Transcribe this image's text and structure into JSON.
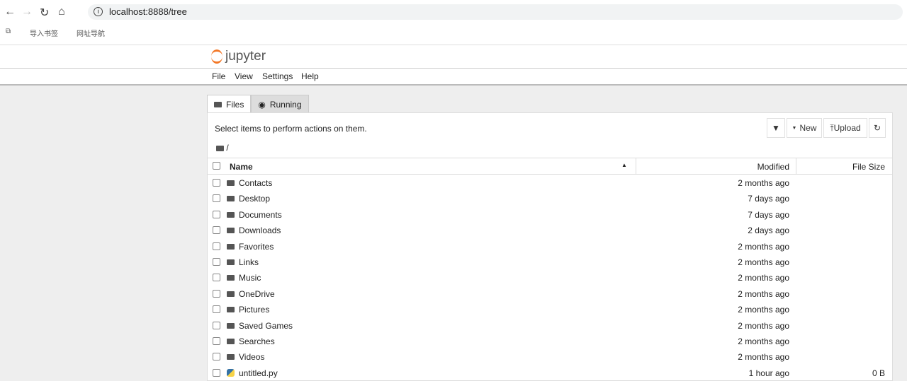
{
  "browser": {
    "url": "localhost:8888/tree",
    "bookmarks": [
      "导入书签",
      "网址导航"
    ]
  },
  "app": {
    "logo": "jupyter",
    "menu": [
      "File",
      "View",
      "Settings",
      "Help"
    ],
    "tabs": [
      "Files",
      "Running"
    ],
    "hint": "Select items to perform actions on them.",
    "toolbar": {
      "new": "New",
      "upload": "Upload"
    },
    "breadcrumb": "/",
    "columns": {
      "name": "Name",
      "modified": "Modified",
      "size": "File Size"
    },
    "rows": [
      {
        "name": "Contacts",
        "modified": "2 months ago",
        "size": "",
        "type": "folder"
      },
      {
        "name": "Desktop",
        "modified": "7 days ago",
        "size": "",
        "type": "folder"
      },
      {
        "name": "Documents",
        "modified": "7 days ago",
        "size": "",
        "type": "folder"
      },
      {
        "name": "Downloads",
        "modified": "2 days ago",
        "size": "",
        "type": "folder"
      },
      {
        "name": "Favorites",
        "modified": "2 months ago",
        "size": "",
        "type": "folder"
      },
      {
        "name": "Links",
        "modified": "2 months ago",
        "size": "",
        "type": "folder"
      },
      {
        "name": "Music",
        "modified": "2 months ago",
        "size": "",
        "type": "folder"
      },
      {
        "name": "OneDrive",
        "modified": "2 months ago",
        "size": "",
        "type": "folder"
      },
      {
        "name": "Pictures",
        "modified": "2 months ago",
        "size": "",
        "type": "folder"
      },
      {
        "name": "Saved Games",
        "modified": "2 months ago",
        "size": "",
        "type": "folder"
      },
      {
        "name": "Searches",
        "modified": "2 months ago",
        "size": "",
        "type": "folder"
      },
      {
        "name": "Videos",
        "modified": "2 months ago",
        "size": "",
        "type": "folder"
      },
      {
        "name": "untitled.py",
        "modified": "1 hour ago",
        "size": "0 B",
        "type": "python"
      }
    ]
  }
}
